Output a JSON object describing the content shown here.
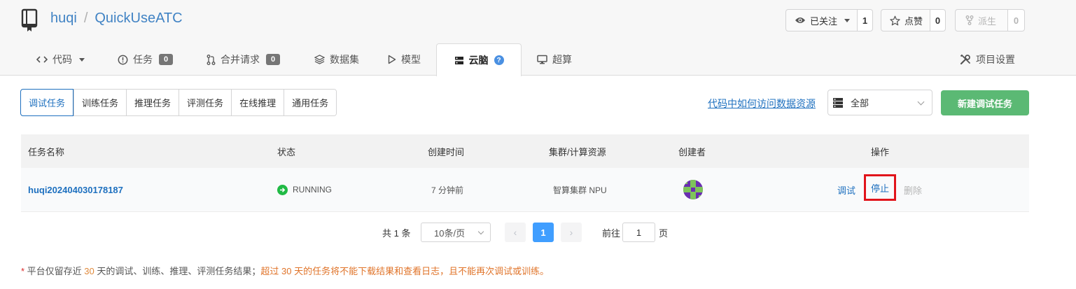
{
  "header": {
    "owner": "huqi",
    "separator": "/",
    "repo": "QuickUseATC",
    "watch": {
      "label": "已关注",
      "count": "1"
    },
    "star": {
      "label": "点赞",
      "count": "0"
    },
    "fork": {
      "label": "派生",
      "count": "0"
    }
  },
  "tabs": [
    {
      "label": "代码"
    },
    {
      "label": "任务",
      "badge": "0"
    },
    {
      "label": "合并请求",
      "badge": "0"
    },
    {
      "label": "数据集"
    },
    {
      "label": "模型"
    },
    {
      "label": "云脑"
    },
    {
      "label": "超算"
    },
    {
      "label": "项目设置"
    }
  ],
  "subtabs": [
    "调试任务",
    "训练任务",
    "推理任务",
    "评测任务",
    "在线推理",
    "通用任务"
  ],
  "data_link": "代码中如何访问数据资源",
  "filter": {
    "value": "全部"
  },
  "new_button": "新建调试任务",
  "table": {
    "headers": [
      "任务名称",
      "状态",
      "创建时间",
      "集群/计算资源",
      "创建者",
      "操作"
    ],
    "rows": [
      {
        "name": "huqi202404030178187",
        "status": "RUNNING",
        "created": "7 分钟前",
        "resource": "智算集群 NPU",
        "actions": {
          "debug": "调试",
          "stop": "停止",
          "delete": "删除"
        }
      }
    ]
  },
  "pagination": {
    "total": "共 1 条",
    "page_size": "10条/页",
    "prev": "‹",
    "current": "1",
    "next": "›",
    "goto_label": "前往",
    "goto_value": "1",
    "goto_suffix": "页"
  },
  "notice": {
    "star": "*",
    "part1": " 平台仅留存近 ",
    "days1": "30",
    "part2": " 天的调试、训练、推理、评测任务结果；",
    "warn": "超过 30 天的任务将不能下载结果和查看日志，且不能再次调试或训练。"
  },
  "colors": {
    "link": "#1e70bf",
    "primary_green": "#5bb974",
    "running": "#21ba45",
    "highlight_box": "#e1141b",
    "pager_active": "#409eff"
  }
}
